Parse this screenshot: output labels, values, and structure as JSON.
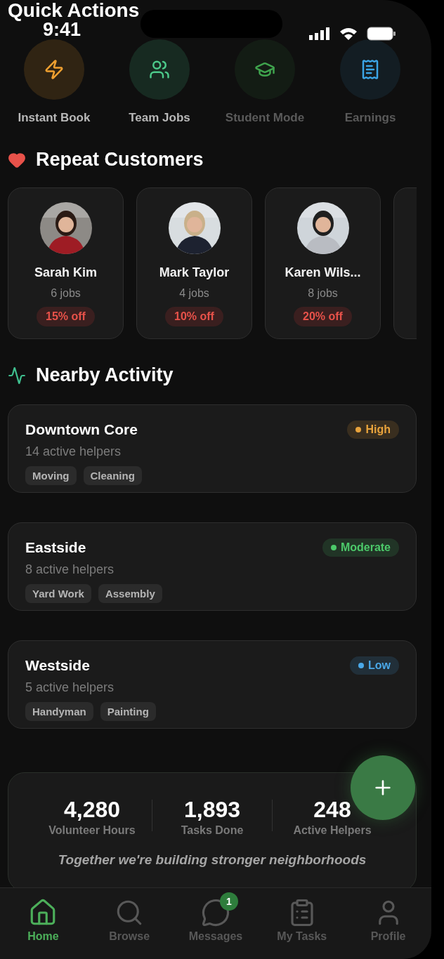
{
  "status_bar": {
    "time": "9:41"
  },
  "quick_actions": {
    "title": "Quick Actions",
    "items": [
      {
        "label": "Instant Book",
        "color": "#f0a030",
        "disabled": false
      },
      {
        "label": "Team Jobs",
        "color": "#4cc98a",
        "disabled": false
      },
      {
        "label": "Student Mode",
        "color": "#3fa34d",
        "disabled": true
      },
      {
        "label": "Earnings",
        "color": "#3ba6e8",
        "disabled": true
      }
    ]
  },
  "repeat_customers": {
    "title": "Repeat Customers",
    "items": [
      {
        "name": "Sarah Kim",
        "jobs": "6 jobs",
        "discount": "15% off"
      },
      {
        "name": "Mark Taylor",
        "jobs": "4 jobs",
        "discount": "10% off"
      },
      {
        "name": "Karen Wils...",
        "jobs": "8 jobs",
        "discount": "20% off"
      }
    ]
  },
  "nearby_activity": {
    "title": "Nearby Activity",
    "areas": [
      {
        "name": "Downtown Core",
        "helpers": "14 active helpers",
        "level": "High",
        "color": "#e8a33c",
        "tags": [
          "Moving",
          "Cleaning"
        ]
      },
      {
        "name": "Eastside",
        "helpers": "8 active helpers",
        "level": "Moderate",
        "color": "#4cc96a",
        "tags": [
          "Yard Work",
          "Assembly"
        ]
      },
      {
        "name": "Westside",
        "helpers": "5 active helpers",
        "level": "Low",
        "color": "#4aa8e8",
        "tags": [
          "Handyman",
          "Painting"
        ]
      }
    ]
  },
  "stats": {
    "items": [
      {
        "value": "4,280",
        "label": "Volunteer Hours"
      },
      {
        "value": "1,893",
        "label": "Tasks Done"
      },
      {
        "value": "248",
        "label": "Active Helpers"
      }
    ],
    "tagline": "Together we're building stronger neighborhoods"
  },
  "tab_bar": [
    {
      "label": "Home",
      "selected": true
    },
    {
      "label": "Browse",
      "selected": false
    },
    {
      "label": "Messages",
      "selected": false,
      "badge": "1"
    },
    {
      "label": "My Tasks",
      "selected": false
    },
    {
      "label": "Profile",
      "selected": false
    }
  ]
}
